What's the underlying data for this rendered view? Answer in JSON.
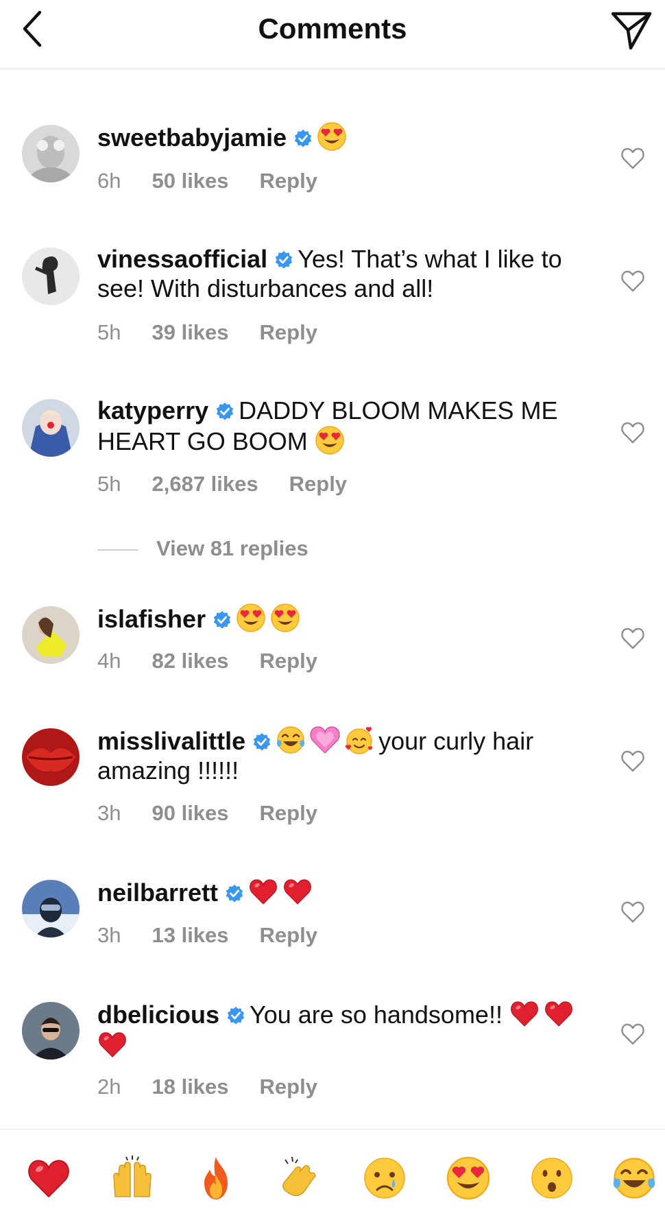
{
  "header": {
    "title": "Comments"
  },
  "comments": [
    {
      "username": "sweetbabyjamie",
      "text": "",
      "emojis": [
        "heart-eyes"
      ],
      "time": "6h",
      "likes": "50 likes",
      "reply": "Reply"
    },
    {
      "username": "vinessaofficial",
      "text": "Yes! That’s what I like to see! With disturbances and all!",
      "emojis": [],
      "time": "5h",
      "likes": "39 likes",
      "reply": "Reply"
    },
    {
      "username": "katyperry",
      "text": "DADDY BLOOM MAKES ME HEART GO BOOM",
      "emojis": [
        "heart-eyes"
      ],
      "time": "5h",
      "likes": "2,687 likes",
      "reply": "Reply",
      "view_replies": "View 81 replies"
    },
    {
      "username": "islafisher",
      "text": "",
      "emojis": [
        "heart-eyes",
        "heart-eyes"
      ],
      "time": "4h",
      "likes": "82 likes",
      "reply": "Reply"
    },
    {
      "username": "misslivalittle",
      "text_before": "",
      "emojis": [
        "tears-of-joy",
        "growing-heart",
        "smiling-hearts"
      ],
      "text": "your curly hair amazing !!!!!!",
      "time": "3h",
      "likes": "90 likes",
      "reply": "Reply"
    },
    {
      "username": "neilbarrett",
      "text": "",
      "emojis": [
        "red-heart",
        "red-heart"
      ],
      "time": "3h",
      "likes": "13 likes",
      "reply": "Reply"
    },
    {
      "username": "dbelicious",
      "text": "You are so handsome!!",
      "emojis": [
        "red-heart",
        "red-heart",
        "red-heart"
      ],
      "time": "2h",
      "likes": "18 likes",
      "reply": "Reply"
    }
  ],
  "quick_emojis": [
    "red-heart",
    "raising-hands",
    "fire",
    "clapping-hands",
    "crying-face",
    "heart-eyes",
    "surprised-face",
    "tears-of-joy"
  ],
  "colors": {
    "verified": "#3897f0",
    "meta_text": "#8e8e8e",
    "primary_text": "#111111",
    "divider": "#e6e6e6"
  }
}
